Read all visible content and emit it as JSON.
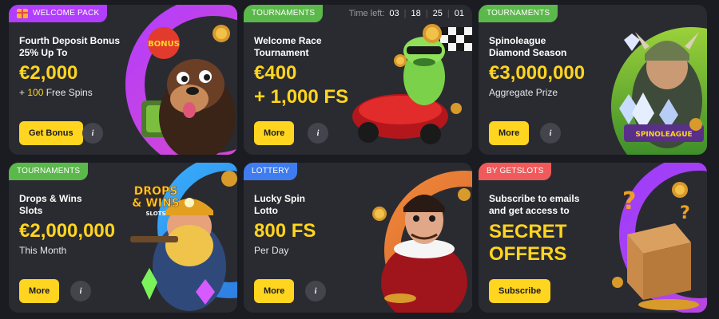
{
  "cards": [
    {
      "badge": "WELCOME PACK",
      "badge_color": "#b13dff",
      "title": "Fourth Deposit Bonus 25% Up To",
      "big": "€2,000",
      "sub_prefix": "+ ",
      "sub_highlight": "100",
      "sub_suffix": " Free Spins",
      "button": "Get Bonus",
      "info": "i",
      "art_logo": "BONUS"
    },
    {
      "badge": "TOURNAMENTS",
      "badge_color": "#5bb84a",
      "timer_label": "Time left:",
      "timer": [
        "03",
        "18",
        "25",
        "01"
      ],
      "title": "Welcome Race Tournament",
      "big_lines": [
        "€400",
        "+ 1,000 FS"
      ],
      "button": "More",
      "info": "i"
    },
    {
      "badge": "TOURNAMENTS",
      "badge_color": "#5bb84a",
      "title": "Spinoleague Diamond Season",
      "big": "€3,000,000",
      "sub": "Aggregate Prize",
      "button": "More",
      "info": "i",
      "art_logo": "SPINOLEAGUE"
    },
    {
      "badge": "TOURNAMENTS",
      "badge_color": "#5bb84a",
      "title": "Drops & Wins Slots",
      "big": "€2,000,000",
      "sub": "This Month",
      "button": "More",
      "info": "i",
      "art_logo_lines": [
        "DROPS",
        "& WINS",
        "SLOTS"
      ]
    },
    {
      "badge": "LOTTERY",
      "badge_color": "#3f7cf0",
      "title": "Lucky Spin Lotto",
      "big": "800 FS",
      "sub": "Per Day",
      "button": "More",
      "info": "i"
    },
    {
      "badge": "BY GETSLOTS",
      "badge_color": "#f05a5a",
      "title": "Subscribe to emails and get access to",
      "big_lines": [
        "SECRET",
        "OFFERS"
      ],
      "button": "Subscribe"
    }
  ]
}
